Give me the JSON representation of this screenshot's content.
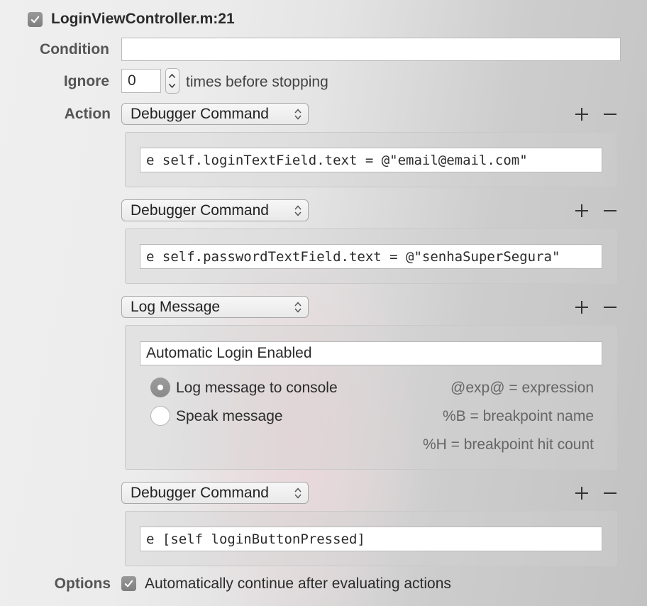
{
  "breakpoint": {
    "name": "LoginViewController.m:21",
    "enabled": true
  },
  "labels": {
    "condition": "Condition",
    "ignore": "Ignore",
    "action": "Action",
    "options": "Options"
  },
  "condition": {
    "value": ""
  },
  "ignore": {
    "count": "0",
    "suffix": "times before stopping"
  },
  "actions": [
    {
      "type": "Debugger Command",
      "command": "e self.loginTextField.text = @\"email@email.com\""
    },
    {
      "type": "Debugger Command",
      "command": "e self.passwordTextField.text = @\"senhaSuperSegura\""
    },
    {
      "type": "Log Message",
      "message": "Automatic Login Enabled",
      "options": [
        "Log message to console",
        "Speak message"
      ],
      "selected": "Log message to console",
      "hints": [
        "@exp@ = expression",
        "%B = breakpoint name",
        "%H = breakpoint hit count"
      ]
    },
    {
      "type": "Debugger Command",
      "command": "e [self loginButtonPressed]"
    }
  ],
  "options": {
    "auto_continue_label": "Automatically continue after evaluating actions",
    "auto_continue": true
  },
  "icons": {
    "add": "plus-icon",
    "remove": "minus-icon",
    "check": "checkmark-icon",
    "chevron": "up-down-chevron-icon"
  }
}
